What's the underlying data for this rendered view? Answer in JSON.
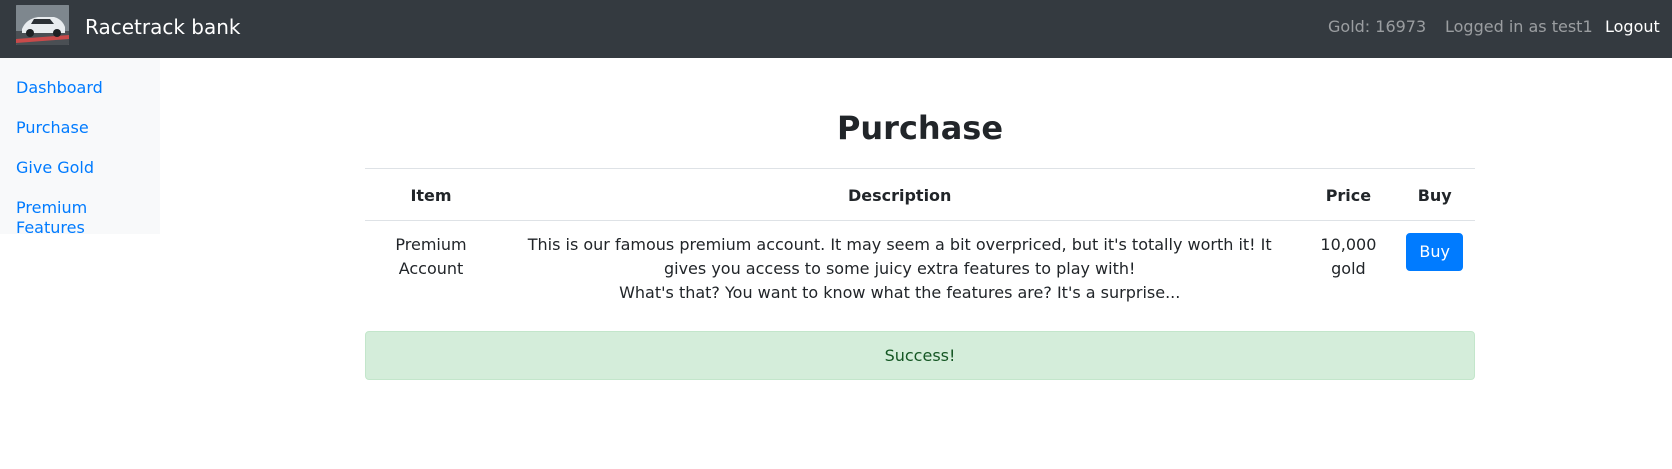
{
  "navbar": {
    "brand": "Racetrack bank",
    "gold": "Gold: 16973",
    "user": "Logged in as test1",
    "logout": "Logout"
  },
  "sidebar": {
    "items": [
      {
        "label": "Dashboard"
      },
      {
        "label": "Purchase"
      },
      {
        "label": "Give Gold"
      },
      {
        "label": "Premium Features"
      }
    ]
  },
  "main": {
    "title": "Purchase",
    "table": {
      "headers": [
        "Item",
        "Description",
        "Price",
        "Buy"
      ],
      "rows": [
        {
          "item": "Premium Account",
          "description_line1": "This is our famous premium account. It may seem a bit overpriced, but it's totally worth it! It gives you access to some juicy extra features to play with!",
          "description_line2": "What's that? You want to know what the features are? It's a surprise...",
          "price": "10,000 gold",
          "buy_label": "Buy"
        }
      ]
    },
    "alert": "Success!"
  },
  "colors": {
    "navbar_bg": "#343a40",
    "link": "#007bff",
    "success_bg": "#d4edda",
    "success_text": "#155724"
  },
  "icons": {
    "logo": "race-car-logo"
  }
}
